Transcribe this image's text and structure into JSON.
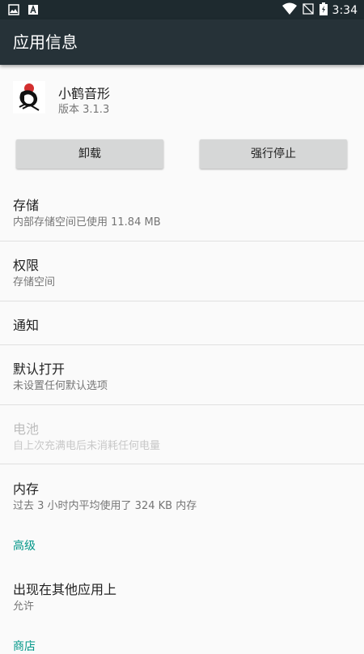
{
  "status_bar": {
    "time": "3:34",
    "icons": [
      "image-icon",
      "font-icon",
      "wifi-icon",
      "no-sim-icon",
      "battery-charging-icon"
    ]
  },
  "toolbar": {
    "title": "应用信息"
  },
  "app": {
    "name": "小鹤音形",
    "version": "版本 3.1.3",
    "icon": "crane-logo-icon"
  },
  "buttons": {
    "uninstall": "卸载",
    "force_stop": "强行停止"
  },
  "items": [
    {
      "title": "存储",
      "subtitle": "内部存储空间已使用 11.84 MB",
      "enabled": true
    },
    {
      "title": "权限",
      "subtitle": "存储空间",
      "enabled": true
    },
    {
      "title": "通知",
      "subtitle": "",
      "enabled": true
    },
    {
      "title": "默认打开",
      "subtitle": "未设置任何默认选项",
      "enabled": true
    },
    {
      "title": "电池",
      "subtitle": "自上次充满电后未消耗任何电量",
      "enabled": false
    },
    {
      "title": "内存",
      "subtitle": "过去 3 小时内平均使用了 324 KB 内存",
      "enabled": true
    }
  ],
  "advanced": {
    "header": "高级",
    "items": [
      {
        "title": "出现在其他应用上",
        "subtitle": "允许"
      }
    ]
  },
  "store": {
    "header": "商店"
  },
  "colors": {
    "toolbar": "#263238",
    "status_bar": "#1e2a2f",
    "accent": "#009688",
    "background": "#fafafa"
  }
}
